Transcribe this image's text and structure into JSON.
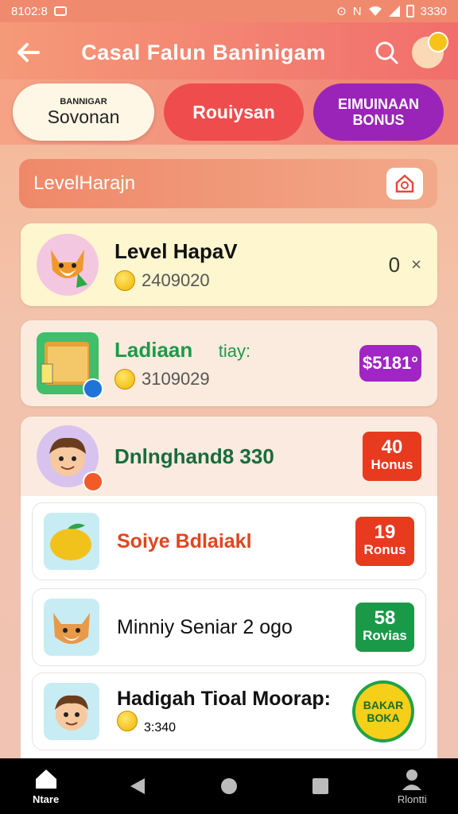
{
  "status_bar": {
    "time": "8102:8",
    "right_time": "3330"
  },
  "app_bar": {
    "title": "Casal Falun Baninigam"
  },
  "tabs": [
    {
      "sub": "BANNIGAR",
      "label": "Sovonan"
    },
    {
      "label": "Rouiysan"
    },
    {
      "label": "EIMUINAAN BONUS"
    }
  ],
  "section": {
    "title": "LevelHarajn"
  },
  "featured": [
    {
      "name": "Level HapaV",
      "coins": "2409020",
      "right": "0",
      "right_icon": "×"
    },
    {
      "name": "Ladiaan",
      "tag": "tiay:",
      "coins": "3109029",
      "price": "$5181°"
    },
    {
      "name": "Dnlnghand8 330",
      "badge_num": "40",
      "badge_label": "Honus"
    }
  ],
  "list": [
    {
      "name": "Soiye Bdlaiakl",
      "badge_num": "19",
      "badge_label": "Ronus"
    },
    {
      "name": "Minniy Seniar 2 ogo",
      "badge_num": "58",
      "badge_label": "Rovias"
    },
    {
      "name": "Hadigah Tioal Moorap:",
      "coins": "3:340",
      "stamp": "BAKAR BOKA"
    }
  ],
  "nav": {
    "home": "Ntare",
    "profile": "Rlontti"
  },
  "colors": {
    "accent": "#f16e6c",
    "red": "#e83a1f",
    "green": "#1a9a48",
    "purple": "#9a24b8"
  }
}
